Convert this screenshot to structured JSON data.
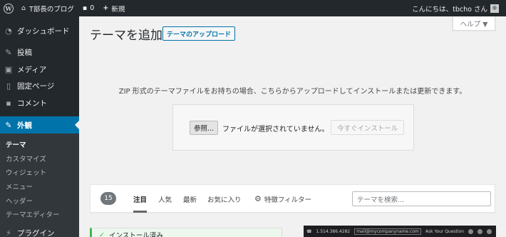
{
  "admin_bar": {
    "site_name": "T部長のブログ",
    "comments_count": "0",
    "new_label": "新規",
    "greeting": "こんにちは、tbcho さん"
  },
  "sidebar": {
    "items": [
      {
        "icon": "dashboard-icon",
        "label": "ダッシュボード"
      },
      {
        "icon": "pin-icon",
        "label": "投稿"
      },
      {
        "icon": "media-icon",
        "label": "メディア"
      },
      {
        "icon": "page-icon",
        "label": "固定ページ"
      },
      {
        "icon": "comment-icon",
        "label": "コメント"
      },
      {
        "icon": "brush-icon",
        "label": "外観"
      },
      {
        "icon": "plugin-icon",
        "label": "プラグイン"
      }
    ],
    "submenu": [
      "テーマ",
      "カスタマイズ",
      "ウィジェット",
      "メニュー",
      "ヘッダー",
      "テーマエディター"
    ]
  },
  "main": {
    "help_label": "ヘルプ ▼",
    "title": "テーマを追加",
    "upload_button": "テーマのアップロード",
    "upload_help": "ZIP 形式のテーマファイルをお持ちの場合、こちらからアップロードしてインストールまたは更新できます。",
    "browse_button": "参照...",
    "file_status": "ファイルが選択されていません。",
    "install_button": "今すぐインストール",
    "count": "15",
    "tabs": [
      "注目",
      "人気",
      "最新",
      "お気に入り",
      "特徴フィルター"
    ],
    "search_placeholder": "テーマを検索...",
    "installed_label": "インストール済み",
    "preview": {
      "phone": "1.514.386.4282",
      "email": "mail@mycompanyname.com",
      "ask": "Ask Your Question"
    }
  },
  "colors": {
    "admin_bg": "#23282d",
    "accent": "#0073aa",
    "submenu_bg": "#32373c",
    "success": "#46b450"
  }
}
